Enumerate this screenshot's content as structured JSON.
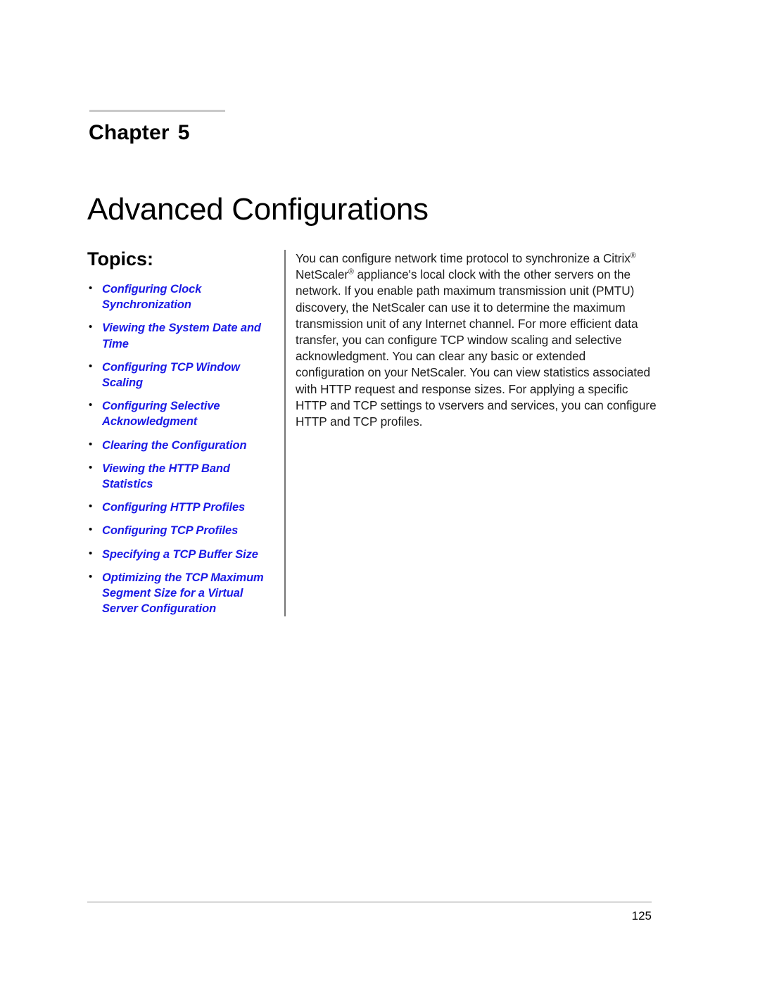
{
  "document": {
    "chapter_label": "Chapter",
    "chapter_number": "5",
    "chapter_title": "Advanced Configurations"
  },
  "topics": {
    "heading": "Topics:",
    "items": [
      {
        "label": "Configuring Clock Synchronization"
      },
      {
        "label": "Viewing the System Date and Time"
      },
      {
        "label": "Configuring TCP Window Scaling"
      },
      {
        "label": "Configuring Selective Acknowledgment"
      },
      {
        "label": "Clearing the Configuration"
      },
      {
        "label": "Viewing the HTTP Band Statistics"
      },
      {
        "label": "Configuring HTTP Profiles"
      },
      {
        "label": "Configuring TCP Profiles"
      },
      {
        "label": "Specifying a TCP Buffer Size"
      },
      {
        "label": "Optimizing the TCP Maximum Segment Size for a Virtual Server Configuration"
      }
    ]
  },
  "intro": {
    "paragraph_part1": "You can configure network time protocol to synchronize a Citrix",
    "trademark1": "®",
    "paragraph_part2": " NetScaler",
    "trademark2": "®",
    "paragraph_part3": " appliance's local clock with the other servers on the network. If you enable path maximum transmission unit (PMTU) discovery, the NetScaler can use it to determine the maximum transmission unit of any Internet channel. For more efficient data transfer, you can configure TCP window scaling and selective acknowledgment. You can clear any basic or extended configuration on your NetScaler. You can view statistics associated with HTTP request and response sizes. For applying a specific HTTP and TCP settings to vservers and services, you can configure HTTP and TCP profiles."
  },
  "footer": {
    "page_number": "125"
  },
  "colors": {
    "link_blue": "#1a1ae6",
    "rule_gray": "#c9c9c9",
    "divider_gray": "#767676",
    "footer_rule_gray": "#d8d8d8",
    "text_black": "#000000"
  }
}
